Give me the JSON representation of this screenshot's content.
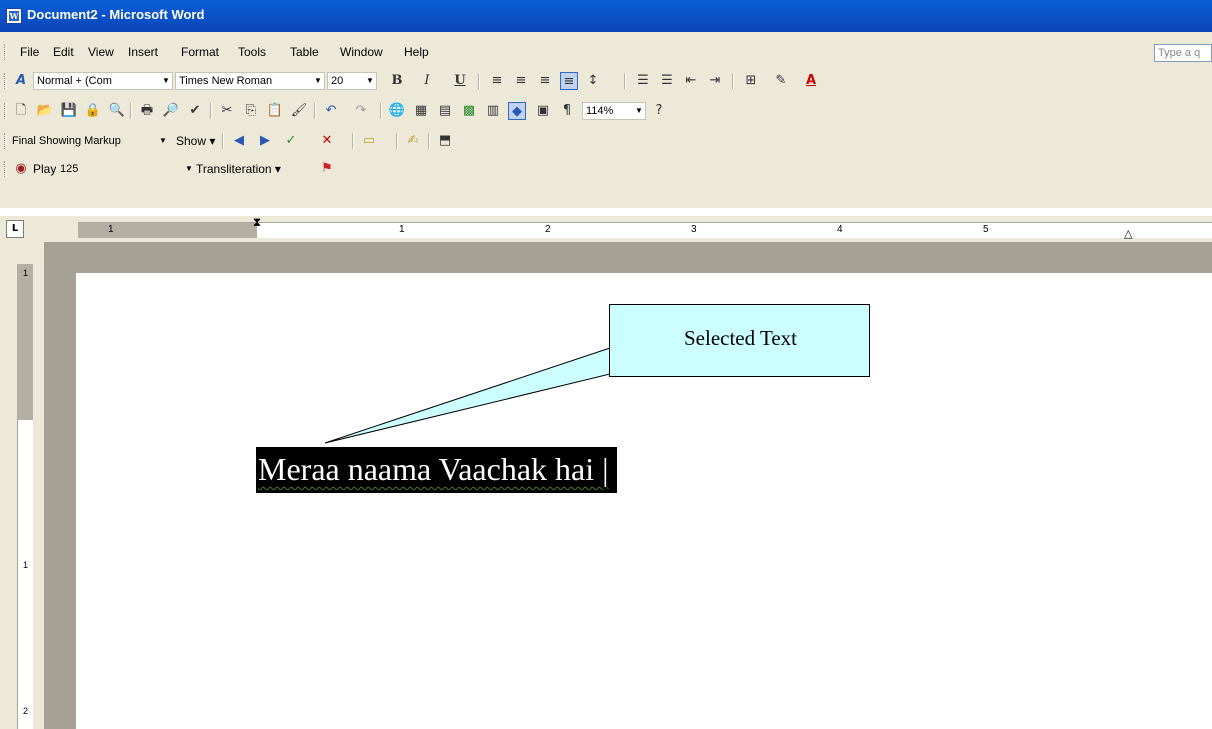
{
  "window": {
    "title": "Document2 - Microsoft Word"
  },
  "menubar": {
    "items": [
      "File",
      "Edit",
      "View",
      "Insert",
      "Format",
      "Tools",
      "Table",
      "Window",
      "Help"
    ],
    "ask_placeholder": "Type a q"
  },
  "formatting": {
    "style": "Normal + (Com",
    "font": "Times New Roman",
    "size": "20"
  },
  "standard": {
    "zoom": "114%"
  },
  "reviewing": {
    "display": "Final Showing Markup",
    "show_label": "Show"
  },
  "speech": {
    "play_label": "Play",
    "rate": "125",
    "mode": "Transliteration"
  },
  "ruler": {
    "tab_marker": "L",
    "numbers": [
      "1",
      "1",
      "2",
      "3",
      "4",
      "5"
    ]
  },
  "vruler": {
    "numbers": [
      "1",
      "1",
      "2"
    ]
  },
  "document": {
    "callout_text": "Selected Text",
    "selected_text": "Meraa naama Vaachak hai |"
  },
  "colors": {
    "titlebar": "#0b4fc6",
    "callout_fill": "#ccffff",
    "selection": "#000000"
  }
}
